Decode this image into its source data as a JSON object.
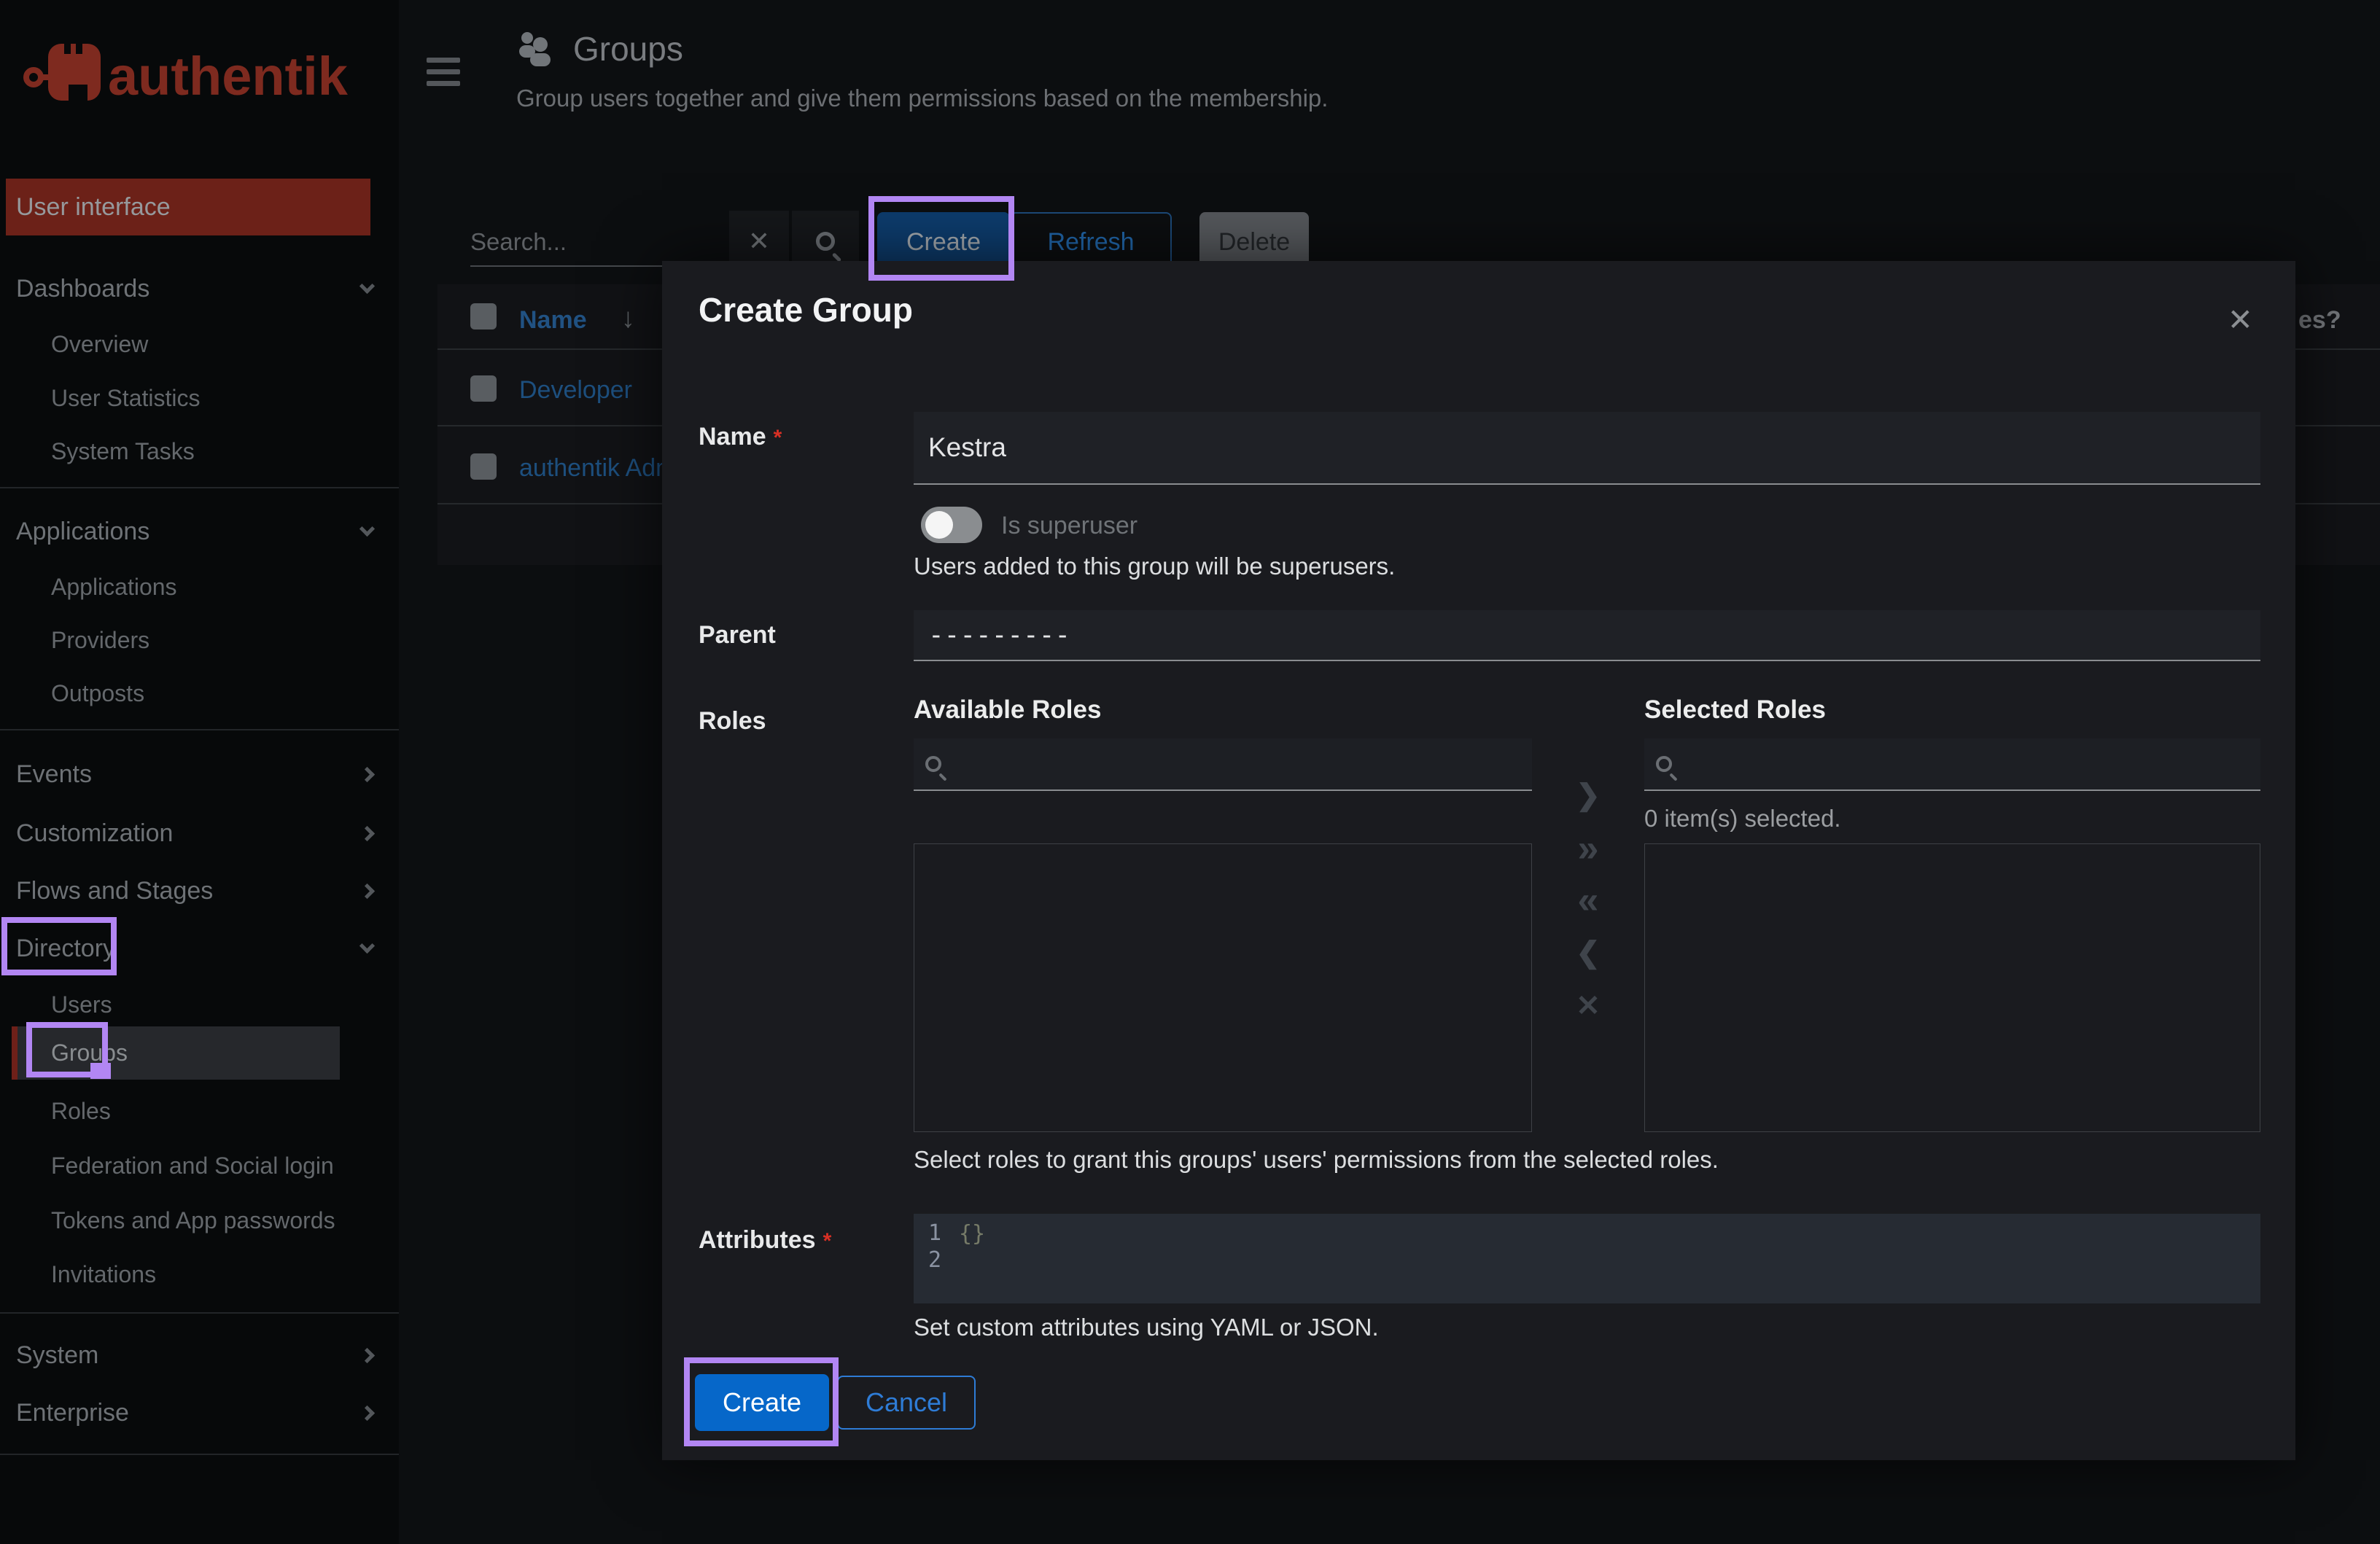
{
  "colors": {
    "brand_red": "#7e2a1f",
    "annotation_purple": "#b286f3",
    "primary_blue": "#0667c9",
    "dimmed_link_blue": "#2065a8",
    "modal_bg": "#1a1b1f"
  },
  "brand": {
    "logo_text": "authentik"
  },
  "sidebar": {
    "user_interface": "User interface",
    "sections": [
      {
        "label": "Dashboards",
        "children": [
          "Overview",
          "User Statistics",
          "System Tasks"
        ]
      },
      {
        "label": "Applications",
        "children": [
          "Applications",
          "Providers",
          "Outposts"
        ]
      },
      {
        "label": "Events"
      },
      {
        "label": "Customization"
      },
      {
        "label": "Flows and Stages"
      },
      {
        "label": "Directory",
        "children": [
          "Users",
          "Groups",
          "Roles",
          "Federation and Social login",
          "Tokens and App passwords",
          "Invitations"
        ]
      },
      {
        "label": "System"
      },
      {
        "label": "Enterprise"
      }
    ]
  },
  "header": {
    "title": "Groups",
    "subtitle": "Group users together and give them permissions based on the membership."
  },
  "toolbar": {
    "search_placeholder": "Search...",
    "clear_icon": "✕",
    "create": "Create",
    "refresh": "Refresh",
    "delete": "Delete"
  },
  "table": {
    "name_header": "Name",
    "sort_icon": "↓",
    "rows": [
      {
        "name": "Developer"
      },
      {
        "name": "authentik Admi"
      }
    ],
    "clipped_right_header": "es?"
  },
  "modal": {
    "title": "Create Group",
    "close_icon": "✕",
    "required_marker": "*",
    "name": {
      "label": "Name",
      "value": "Kestra"
    },
    "superuser": {
      "label": "Is superuser",
      "help": "Users added to this group will be superusers."
    },
    "parent": {
      "label": "Parent",
      "value": "---------"
    },
    "roles": {
      "label": "Roles",
      "available_heading": "Available Roles",
      "selected_heading": "Selected Roles",
      "selected_count": "0 item(s) selected.",
      "help": "Select roles to grant this groups' users' permissions from the selected roles.",
      "transfer": {
        "right": "❯",
        "all_right": "»",
        "all_left": "«",
        "left": "❮",
        "remove": "✕"
      }
    },
    "attributes": {
      "label": "Attributes",
      "line_numbers": [
        "1",
        "2"
      ],
      "placeholder": "{}",
      "help": "Set custom attributes using YAML or JSON."
    },
    "footer": {
      "create": "Create",
      "cancel": "Cancel"
    }
  }
}
